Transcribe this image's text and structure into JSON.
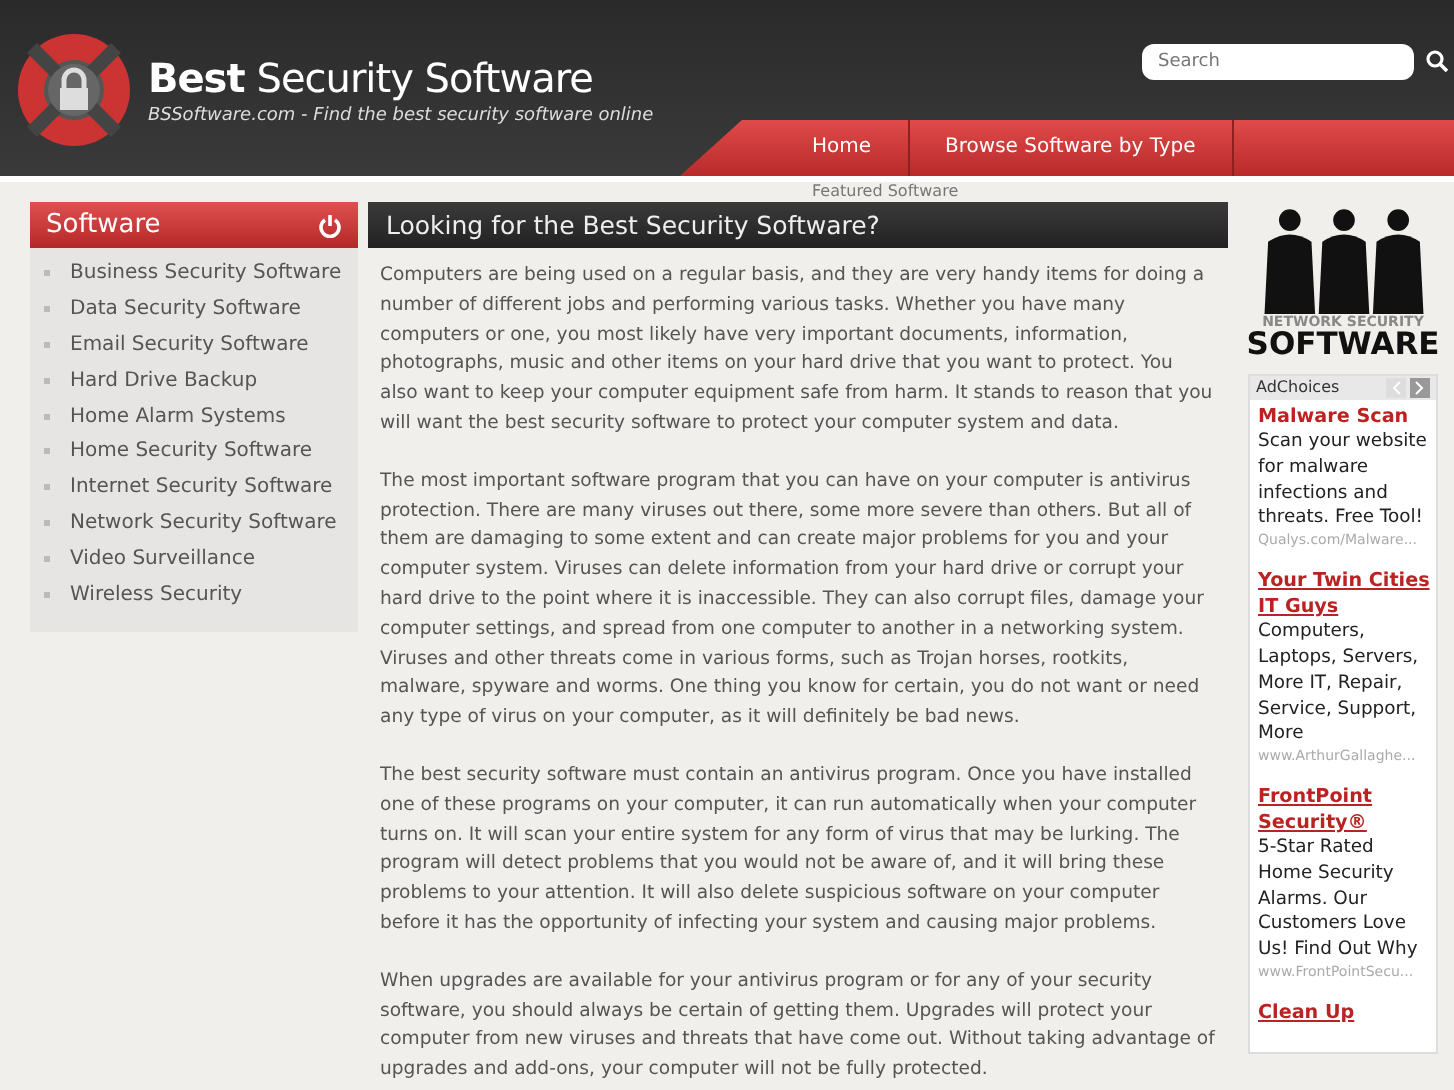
{
  "header": {
    "logo_bold": "Best",
    "logo_rest": "Security Software",
    "tagline": "BSSoftware.com - Find the best security software online",
    "search": {
      "placeholder": "Search"
    }
  },
  "nav": [
    {
      "label": "Home",
      "selected": false
    },
    {
      "label": "Browse Software by Type",
      "selected": false
    },
    {
      "label": "Featured Software",
      "selected": false
    }
  ],
  "sidebar": {
    "title": "Software",
    "items": [
      "Business Security Software",
      "Data Security Software",
      "Email Security Software",
      "Hard Drive Backup",
      "Home Alarm Systems",
      "Home Security Software",
      "Internet Security Software",
      "Network Security Software",
      "Video Surveillance",
      "Wireless Security"
    ]
  },
  "article": {
    "title": "Looking for the Best Security Software?",
    "paragraphs": [
      "Computers are being used on a regular basis, and they are very handy items for doing a number of different jobs and performing various tasks. Whether you have many computers or one, you most likely have very important documents, information, photographs, music and other items on your hard drive that you want to protect. You also want to keep your computer equipment safe from harm. It stands to reason that you will want the best security software to protect your computer system and data.",
      "The most important software program that you can have on your computer is antivirus protection. There are many viruses out there, some more severe than others. But all of them are damaging to some extent and can create major problems for you and your computer system. Viruses can delete information from your hard drive or corrupt your hard drive to the point where it is inaccessible. They can also corrupt files, damage your computer settings, and spread from one computer to another in a networking system. Viruses and other threats come in various forms, such as Trojan horses, rootkits, malware, spyware and worms. One thing you know for certain, you do not want or need any type of virus on your computer, as it will definitely be bad news.",
      "The best security software must contain an antivirus program. Once you have installed one of these programs on your computer, it can run automatically when your computer turns on. It will scan your entire system for any form of virus that may be lurking. The program will detect problems that you would not be aware of, and it will bring these problems to your attention. It will also delete suspicious software on your computer before it has the opportunity of infecting your system and causing major problems.",
      "When upgrades are available for your antivirus program or for any of your security software, you should always be certain of getting them. Upgrades will protect your computer from new viruses and threats that have come out. Without taking advantage of upgrades and add-ons, your computer will not be fully protected."
    ]
  },
  "banner": {
    "line1": "NETWORK SECURITY",
    "line2": "SOFTWARE"
  },
  "ads": {
    "label": "AdChoices",
    "items": [
      {
        "title": "Malware Scan",
        "underlined": false,
        "text": "Scan your website for malware infections and threats. Free Tool!",
        "url": "Qualys.com/Malware..."
      },
      {
        "title": "Your Twin Cities IT Guys",
        "underlined": true,
        "text": "Computers, Laptops, Servers, More IT, Repair, Service, Support, More",
        "url": "www.ArthurGallaghe..."
      },
      {
        "title": "FrontPoint Security®",
        "underlined": true,
        "text": "5-Star Rated Home Security Alarms. Our Customers Love Us! Find Out Why",
        "url": "www.FrontPointSecu..."
      },
      {
        "title": "Clean Up",
        "underlined": true
      }
    ]
  }
}
